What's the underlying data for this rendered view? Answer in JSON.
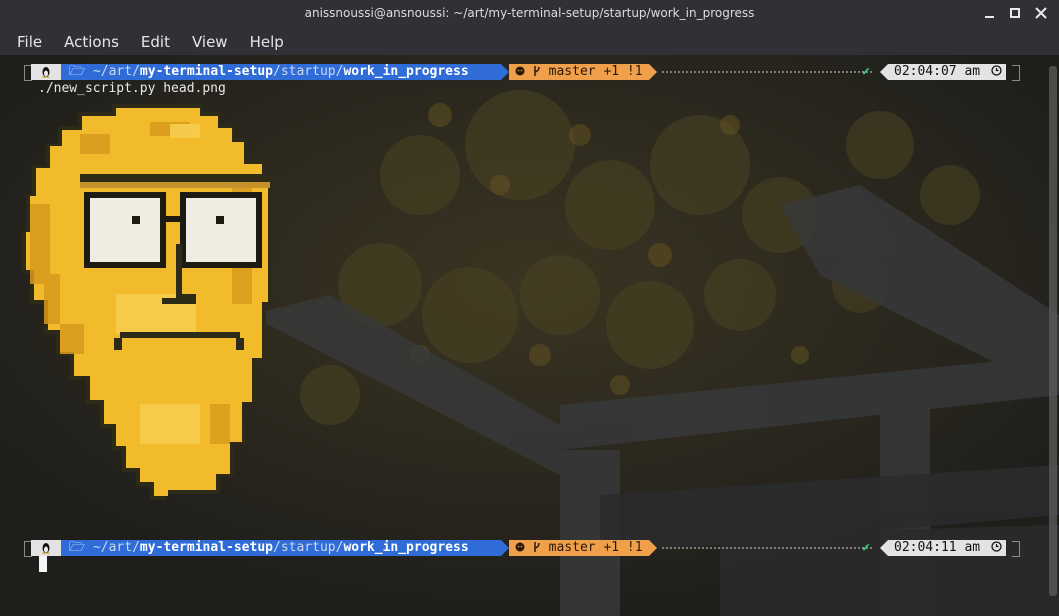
{
  "window": {
    "title": "anissnoussi@ansnoussi: ~/art/my-terminal-setup/startup/work_in_progress"
  },
  "menu": {
    "items": [
      "File",
      "Actions",
      "Edit",
      "View",
      "Help"
    ]
  },
  "prompts": [
    {
      "os_icon": "linux-tux-icon",
      "folder_icon": "folder-icon",
      "path_home": "~/",
      "path_seg1": "art",
      "path_sep1": "/",
      "path_seg2": "my-terminal-setup",
      "path_sep2": "/",
      "path_seg3": "startup",
      "path_sep3": "/",
      "path_seg4": "work_in_progress",
      "git_icon": "github-icon",
      "branch_icon": "git-branch-icon",
      "git_status": "master +1 !1",
      "status_icon": "check-icon",
      "status_glyph": "✔",
      "time": "02:04:07 am",
      "clock_icon": "clock-icon"
    },
    {
      "os_icon": "linux-tux-icon",
      "folder_icon": "folder-icon",
      "path_home": "~/",
      "path_seg1": "art",
      "path_sep1": "/",
      "path_seg2": "my-terminal-setup",
      "path_sep2": "/",
      "path_seg3": "startup",
      "path_sep3": "/",
      "path_seg4": "work_in_progress",
      "git_icon": "github-icon",
      "branch_icon": "git-branch-icon",
      "git_status": "master +1 !1",
      "status_icon": "check-icon",
      "status_glyph": "✔",
      "time": "02:04:11 am",
      "clock_icon": "clock-icon"
    }
  ],
  "command": "./new_script.py head.png",
  "colors": {
    "path_segment": "#2f6cd8",
    "git_segment": "#f0a04a",
    "time_segment": "#e3e3e3",
    "status_ok": "#38c77d",
    "head_yellow": "#f2bb2c"
  }
}
